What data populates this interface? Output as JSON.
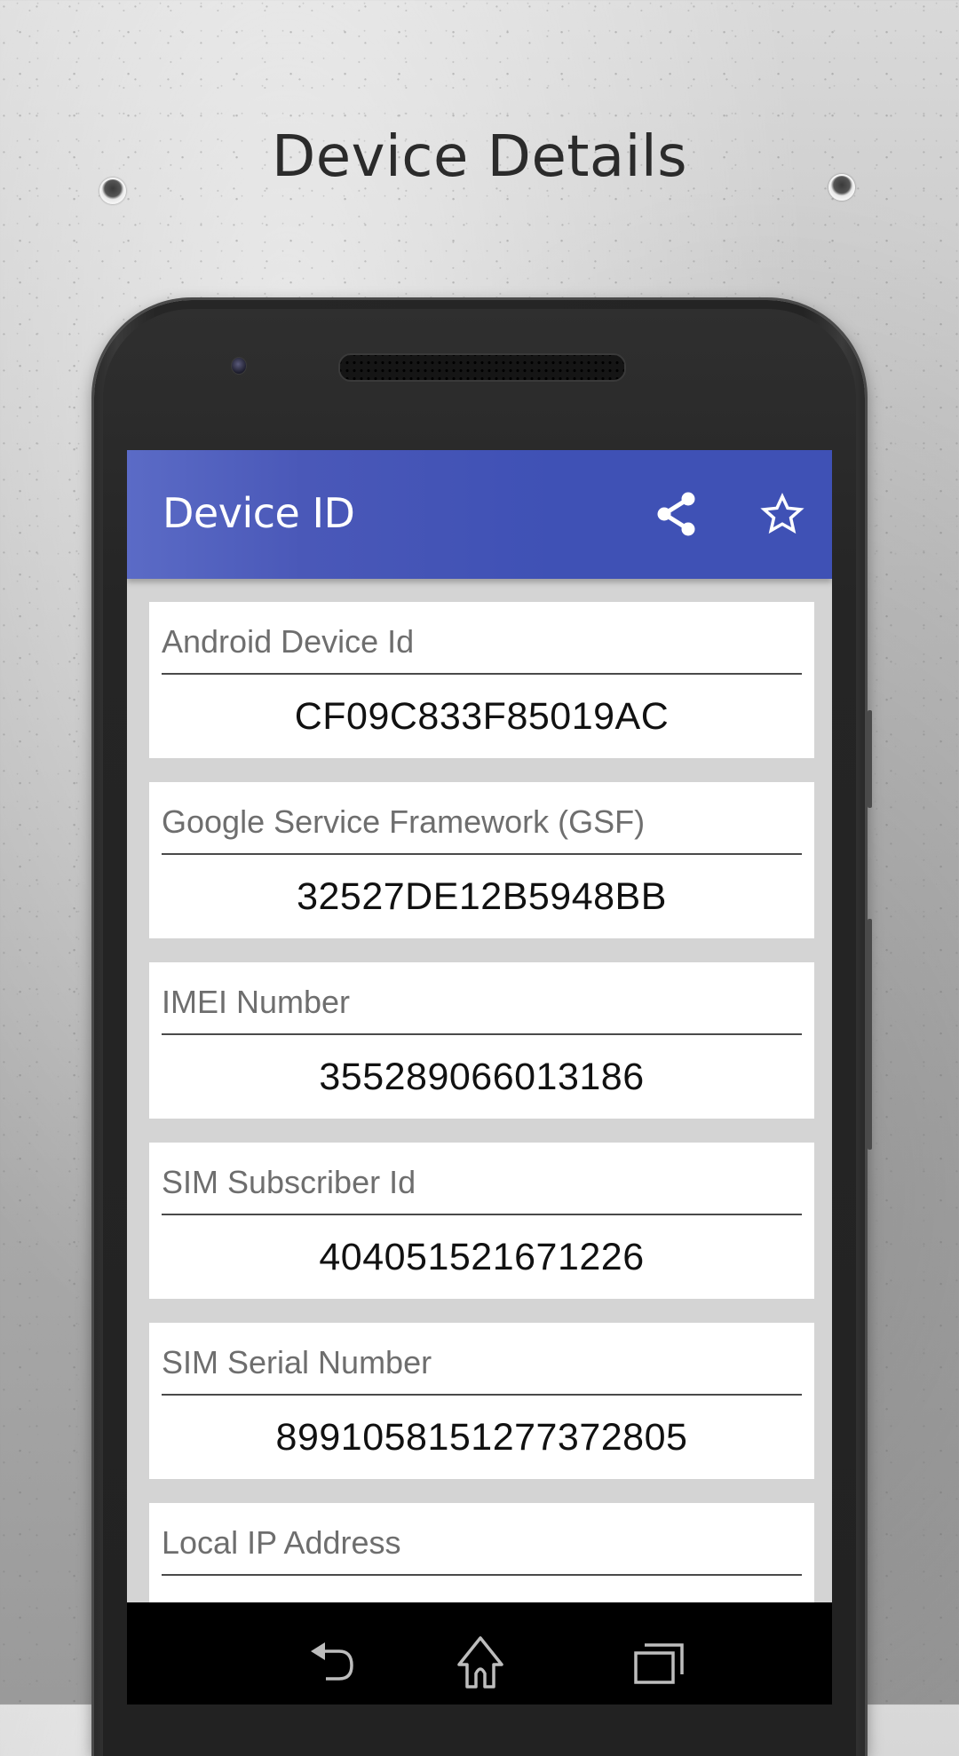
{
  "page": {
    "headline": "Device Details"
  },
  "app": {
    "title": "Device ID",
    "actions": [
      {
        "name": "share",
        "icon": "share-icon"
      },
      {
        "name": "favorite",
        "icon": "star-outline-icon"
      }
    ],
    "accent_color": "#3f51b5"
  },
  "cards": [
    {
      "label": "Android Device Id",
      "value": "CF09C833F85019AC"
    },
    {
      "label": "Google Service Framework (GSF)",
      "value": "32527DE12B5948BB"
    },
    {
      "label": "IMEI Number",
      "value": "355289066013186"
    },
    {
      "label": "SIM Subscriber Id",
      "value": "404051521671226"
    },
    {
      "label": "SIM Serial Number",
      "value": "8991058151277372805"
    },
    {
      "label": "Local IP Address",
      "value": ""
    }
  ],
  "navbar": {
    "buttons": [
      {
        "name": "back",
        "icon": "back-icon"
      },
      {
        "name": "home",
        "icon": "home-icon"
      },
      {
        "name": "recents",
        "icon": "recents-icon"
      }
    ]
  }
}
